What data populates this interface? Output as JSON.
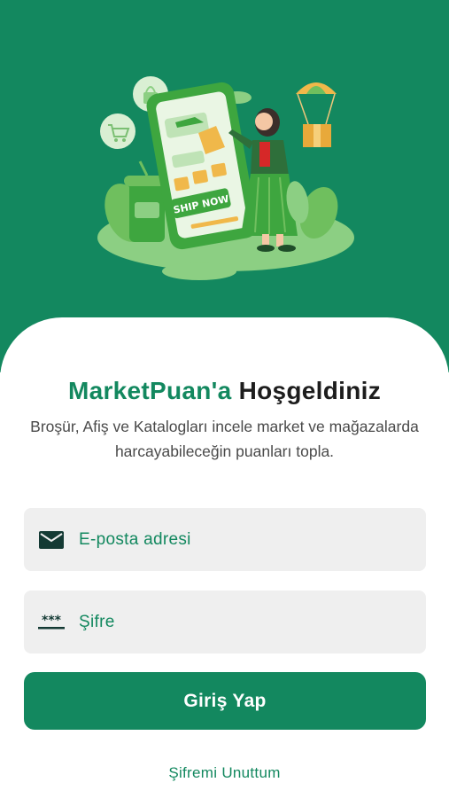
{
  "header": {
    "illustration": "shopping-illustration",
    "phone_banner_text": "SHIP NOW"
  },
  "welcome": {
    "brand": "MarketPuan'a",
    "rest": "Hoşgeldiniz",
    "subtitle": "Broşür, Afiş ve Katalogları incele market ve mağazalarda harcayabileceğin puanları topla."
  },
  "form": {
    "email_placeholder": "E-posta adresi",
    "email_value": "",
    "email_icon": "mail-icon",
    "password_placeholder": "Şifre",
    "password_value": "",
    "password_icon": "password-dots-icon"
  },
  "login_button": "Giriş Yap",
  "forgot_password": "Şifremi Unuttum",
  "colors": {
    "primary": "#13885f",
    "field_bg": "#efefef",
    "text_dark": "#1d1d1d",
    "text_muted": "#4a4a4a"
  }
}
